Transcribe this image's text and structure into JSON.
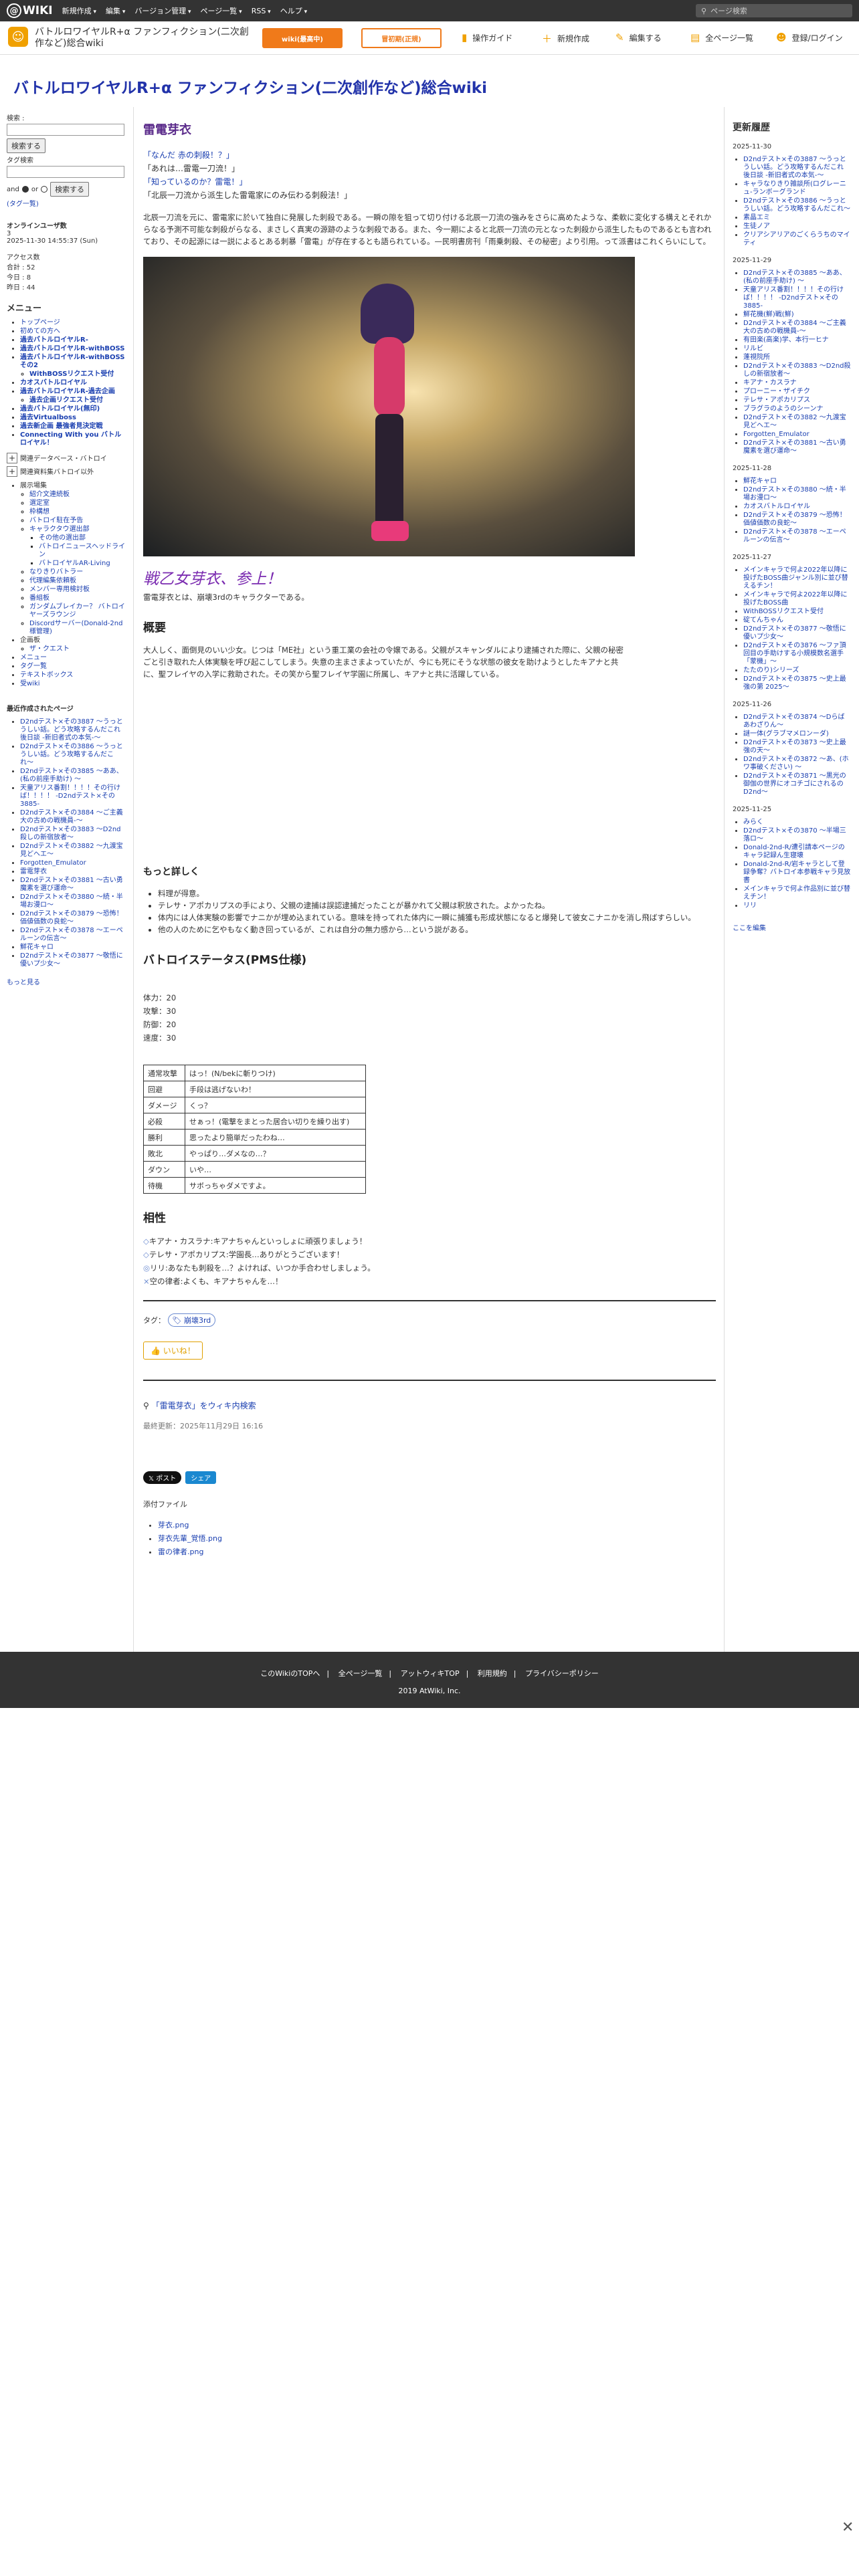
{
  "topbar": {
    "logo": "WIKI",
    "menus": [
      "新規作成",
      "編集",
      "バージョン管理",
      "ページ一覧",
      "RSS",
      "ヘルプ"
    ],
    "search_placeholder": "ページ検索"
  },
  "subbar": {
    "wiki_title": "バトルロワイヤルR+α ファンフィクション(二次創作など)総合wiki",
    "btn_primary": "wiki(最高中)",
    "btn_outline": "冒初期(正規)",
    "tools": [
      "操作ガイド",
      "新規作成",
      "編集する",
      "全ページ一覧",
      "登録/ログイン"
    ]
  },
  "headline": "バトルロワイヤルR+α ファンフィクション(二次創作など)総合wiki",
  "left": {
    "search_label": "検索 :",
    "search_button": "検索する",
    "tag_label": "タグ検索",
    "and_label": "and",
    "or_label": "or",
    "tag_button": "検索する",
    "tag_list": "(タグ一覧)",
    "online_title": "オンラインユーザ数",
    "online_value": "3",
    "online_time": "2025-11-30 14:55:37 (Sun)",
    "access_label": "アクセス数",
    "access_total": "合計 : 52",
    "access_today": "今日 : 8",
    "access_yesterday": "昨日 : 44",
    "menu_title": "メニュー",
    "menu_items": [
      {
        "label": "トップページ",
        "bold": false
      },
      {
        "label": "初めての方へ",
        "bold": false
      },
      {
        "label": "過去バトルロイヤルR-",
        "bold": true
      },
      {
        "label": "過去バトルロイヤルR-withBOSS",
        "bold": true
      },
      {
        "label": "過去バトルロイヤルR-withBOSSその2",
        "bold": true
      },
      {
        "label": "WithBOSSリクエスト受付",
        "bold": false,
        "sub": true
      },
      {
        "label": "カオスバトルロイヤル",
        "bold": true
      },
      {
        "label": "過去バトルロイヤルR-過去企画",
        "bold": true
      },
      {
        "label": "過去企画リクエスト受付",
        "bold": false,
        "sub": true
      },
      {
        "label": "過去バトルロイヤル(無印)",
        "bold": true
      },
      {
        "label": "過去Virtualboss",
        "bold": true
      },
      {
        "label": "過去新企画 最強者見決定戦",
        "bold": true
      },
      {
        "label": "Connecting With you バトルロイヤル！",
        "bold": true
      }
    ],
    "expand1": "関連データベース・バトロイ",
    "expand2": "関連資料集バトロイ以外",
    "show_label": "展示場集",
    "show_items": [
      "紹介文連続板",
      "選定室",
      "枠構想",
      "バトロイ駐在予告",
      "キャラクタウ選出部",
      "その他の選出部",
      "バトロイニュースヘッドライン",
      "バトロイヤルAR-Living",
      "なりきりバトラー",
      "代理編集依頼板",
      "メンバー専用検討板",
      "番組板",
      "ガンダムブレイカー？ バトロイヤーズラウンジ",
      "Discordサーバー(Donald-2nd様管理)"
    ],
    "plan_label": "企画板",
    "plan_items": [
      "ザ・クエスト"
    ],
    "misc_items": [
      "メニュー",
      "タグ一覧",
      "テキストボックス",
      "受wiki"
    ],
    "recent_title": "最近作成されたページ",
    "recent_items": [
      "D2ndテスト×その3887 〜うっとうしい話。どう攻略するんだこれ　後日談 -新旧者式の本気-〜",
      "D2ndテスト×その3886 〜うっとうしい話。どう攻略するんだこれ〜",
      "D2ndテスト×その3885 〜ああ、(私の前座手助け) 〜",
      "天童アリス番割！！！！その行けば！！！！ -D2ndテスト×その3885-",
      "D2ndテスト×その3884 〜ご主義大の古めの戦機員-〜",
      "D2ndテスト×その3883 〜D2nd殺しの新宿放者〜",
      "D2ndテスト×その3882 〜九渡宝見どヘエ〜",
      "Forgotten_Emulator",
      "雷電芽衣",
      "D2ndテスト×その3881 〜古い勇魔素を選び運命〜",
      "D2ndテスト×その3880 〜続・半場お漫ロ〜",
      "D2ndテスト×その3879 〜恐怖！価値価数の良蛇〜",
      "D2ndテスト×その3878 〜エーペルーンの伝言〜",
      "鮮花キャロ",
      "D2ndテスト×その3877 〜敬悟に優いプ少女〜"
    ],
    "more_link": "もっと見る"
  },
  "main": {
    "page_title": "雷電芽衣",
    "quotes": [
      "「なんだ 赤の刺殺！？」",
      "「あれは…雷電一刀流！」",
      "「知っているのか？雷電！」",
      "「北辰一刀流から派生した雷電家にのみ伝わる刺殺法！」"
    ],
    "intro_para": "北辰一刀流を元に、雷電家に於いて独自に発展した刺殺である。一瞬の隙を狙って切り付ける北辰一刀流の強みをさらに高めたような、柔軟に変化する構えとそれからなる予測不可能な刺殺がらなる、まさしく真実の源跡のような刺殺である。また、今一期によると北辰一刀流の元となった刺殺から派生したものであるとも言われており、その起源には一説によるとある刺暴「雷電」が存在するとも語られている。—民明書房刊「雨乗刺殺、その秘密」より引用。って派書はこれくらいにして。",
    "hero_alt": "雷電芽衣イラスト",
    "big_title": "戦乙女芽衣、参上！",
    "big_sub": "雷電芽衣とは、崩壊3rdのキャラクターである。",
    "overview_title": "概要",
    "overview_para": "大人しく、面倒見のいい少女。じつは「ME社」という重工業の会社の令嬢である。父親がスキャンダルにより逮捕された際に、父親の秘密ごと引き取れた人体実験を呼び起こしてしまう。失意の主まさまよっていたが、今にも死にそうな状態の彼女を助けようとしたキアナと共に、聖フレイヤの入学に救助された。その笑から聖フレイヤ学園に所属し、キアナと共に活躍している。",
    "detail_title": "もっと詳しく",
    "detail_items": [
      "料理が得意。",
      "テレサ・アポカリプスの手により、父親の逮捕は誤認逮捕だったことが暴かれて父親は釈放された。よかったね。",
      "体内には人体実験の影響でナニかが埋め込まれている。意味を持ってれた体内に一瞬に捕獲も形成状態になると爆発して彼女こナニかを消し飛ばすらしい。",
      "他の人のために乞やもなく動き回っているが、これは自分の無力感から…という説がある。"
    ],
    "status_title": "バトロイステータス(PMS仕様)",
    "stats": [
      "体力：20",
      "攻撃：30",
      "防御：20",
      "速度：30"
    ],
    "moves": [
      [
        "通常攻撃",
        "はっ！(N/bekに斬りつけ)"
      ],
      [
        "回避",
        "手段は逃げないわ！"
      ],
      [
        "ダメージ",
        "くっ？"
      ],
      [
        "必殺",
        "せぁっ！(電撃をまとった居合い切りを繰り出す)"
      ],
      [
        "勝利",
        "思ったより簡単だったわね…"
      ],
      [
        "敗北",
        "やっぱり…ダメなの…？"
      ],
      [
        "ダウン",
        "いや…"
      ],
      [
        "待機",
        "サボっちゃダメですよ。"
      ]
    ],
    "compat_title": "相性",
    "compat_items": [
      {
        "mark": "◇",
        "text": "キアナ・カスラナ:キアナちゃんといっしょに頑張りましょう！"
      },
      {
        "mark": "◇",
        "text": "テレサ・アポカリプス:学園長…ありがとうございます！"
      },
      {
        "mark": "◎",
        "text": "リリ:あなたも刺殺を…？よければ、いつか手合わせしましょう。"
      },
      {
        "mark": "×",
        "text": "空の律者:よくも、キアナちゃんを…！"
      }
    ],
    "tag_label": "タグ：",
    "tag_value": "崩壊3rd",
    "like_label": "いいね！",
    "search_text": "「雷電芽衣」をウィキ内検索",
    "updated": "最終更新：2025年11月29日 16:16",
    "social_x": "ポスト",
    "social_f": "シェア",
    "attach_title": "添付ファイル",
    "attach_items": [
      "芽衣.png",
      "芽衣先輩_覚悟.png",
      "雷の律者.png"
    ]
  },
  "right": {
    "title": "更新履歴",
    "groups": [
      {
        "date": "2025-11-30",
        "items": [
          "D2ndテスト×その3887 〜うっとうしい話。どう攻略するんだこれ　後日談 -新旧者式の本気-〜",
          "キャラなりきり雑談所(ログレーニュ-ランボーグランド",
          "D2ndテスト×その3886 〜うっとうしい話。どう攻略するんだこれ〜",
          "素晶エミ",
          "生徒ノア",
          "クリアシアリアのごくらうちのマイティ"
        ]
      },
      {
        "date": "2025-11-29",
        "items": [
          "D2ndテスト×その3885 〜ああ、(私の前座手助け) 〜",
          "天童アリス番割！！！！その行けば！！！！ -D2ndテスト×その3885-",
          "鮮花機(鮮)戦(鮮)",
          "D2ndテスト×その3884 〜ご主義大の古めの戦機員-〜",
          "有田楽(高楽)学、本行一ヒナ",
          "リルビ",
          "蓬視院所",
          "D2ndテスト×その3883 〜D2nd殺しの新宿放者〜",
          "キアナ・カスラナ",
          "プローニー・ザイチク",
          "テレサ・アポカリプス",
          "ブラグラのようのシーンナ",
          "D2ndテスト×その3882 〜九渡宝見どヘエ〜",
          "Forgotten_Emulator",
          "D2ndテスト×その3881 〜古い勇魔素を選び運命〜"
        ]
      },
      {
        "date": "2025-11-28",
        "items": [
          "鮮花キャロ",
          "D2ndテスト×その3880 〜続・半場お漫ロ〜",
          "カオスバトルロイヤル",
          "D2ndテスト×その3879 〜恐怖！価値価数の良蛇〜",
          "D2ndテスト×その3878 〜エーペルーンの伝言〜"
        ]
      },
      {
        "date": "2025-11-27",
        "items": [
          "メインキャラで何よ2022年以降に投げたBOSS曲ジャンル別に並び替えるチン！",
          "メインキャラで何よ2022年以降に投げたBOSS曲",
          "WithBOSSリクエスト受付",
          "碇てんちゃん",
          "D2ndテスト×その3877 〜敬悟に優いプ少女〜",
          "D2ndテスト×その3876 〜ファ頂回目の手助けする小規模数名選手「蒙機」〜",
          "たたのり)シリーズ",
          "D2ndテスト×その3875 〜史上最強の第 2025〜"
        ]
      },
      {
        "date": "2025-11-26",
        "items": [
          "D2ndテスト×その3874 〜Dらばあわざりん〜",
          "謎一体(グラブマメロンーダ)",
          "D2ndテスト×その3873 〜史上最強の天〜",
          "D2ndテスト×その3872 〜あ、(ホワ事破ください) 〜",
          "D2ndテスト×その3871 〜黒光の御伽の世界にオコチゴにされるのD2nd〜"
        ]
      },
      {
        "date": "2025-11-25",
        "items": [
          "みらく",
          "D2ndテスト×その3870 〜半場三落ロ〜",
          "Donald-2nd-R/遭引請本ページのキャラ記録ん生寝壊",
          "Donald-2nd-R/岩キャラとして登録争奪？バトロイ本参戦キャラ見放書",
          "メインキャラで何よ作品別に並び替えチン！",
          "リリ"
        ]
      }
    ],
    "edit_link": "ここを編集"
  },
  "footer": {
    "links": [
      "このWikiのTOPへ",
      "全ページ一覧",
      "アットウィキTOP",
      "利用規約",
      "プライバシーポリシー"
    ],
    "copyright": "2019 AtWiki, Inc."
  }
}
